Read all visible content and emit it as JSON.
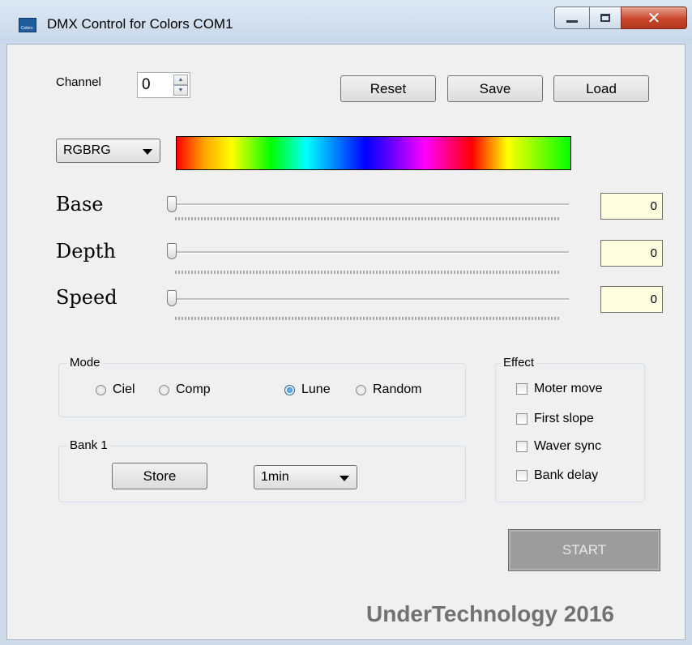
{
  "window": {
    "title": "DMX Control for Colors  COM1",
    "icon_text": "Colors",
    "controls": [
      "minimize-icon",
      "maximize-icon",
      "close-icon"
    ]
  },
  "channel": {
    "label": "Channel",
    "value": "0"
  },
  "toolbar": {
    "reset_label": "Reset",
    "save_label": "Save",
    "load_label": "Load"
  },
  "pattern": {
    "selected": "RGBRG",
    "gradient_colors": [
      "#ff0000",
      "#ffa500",
      "#ffff00",
      "#00ff00",
      "#00ffff",
      "#0000ff",
      "#8000ff",
      "#ff00ff",
      "#ff0000",
      "#ffff00",
      "#00ff00"
    ]
  },
  "sliders": [
    {
      "label": "Base",
      "value": "0",
      "level": 0
    },
    {
      "label": "Depth",
      "value": "0",
      "level": 0
    },
    {
      "label": "Speed",
      "value": "0",
      "level": 0
    }
  ],
  "mode": {
    "title": "Mode",
    "options": [
      {
        "label": "Ciel",
        "selected": false
      },
      {
        "label": "Comp",
        "selected": false
      },
      {
        "label": "Lune",
        "selected": true
      },
      {
        "label": "Random",
        "selected": false
      }
    ]
  },
  "bank": {
    "title": "Bank 1",
    "store_label": "Store",
    "interval": "1min"
  },
  "effect": {
    "title": "Effect",
    "options": [
      {
        "label": "Moter move",
        "checked": false
      },
      {
        "label": "First slope",
        "checked": false
      },
      {
        "label": "Waver sync",
        "checked": false
      },
      {
        "label": "Bank delay",
        "checked": false
      }
    ]
  },
  "start_label": "START",
  "brand": "UnderTechnology 2016",
  "colors": {
    "value_box_bg": "#ffffe0",
    "start_bg": "#9c9c9c",
    "brand_text": "#727272"
  }
}
